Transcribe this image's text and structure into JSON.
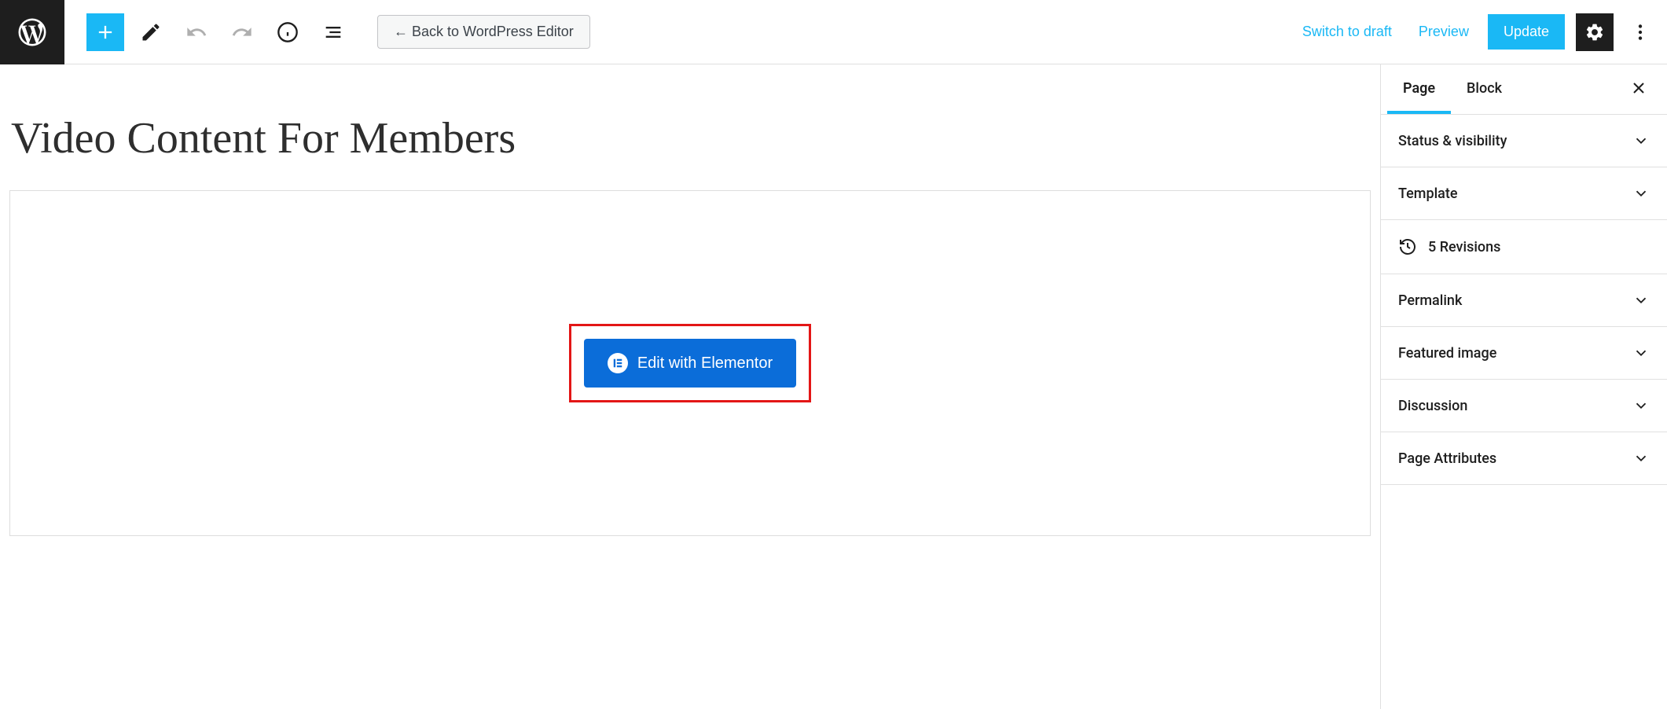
{
  "toolbar": {
    "back_btn_label": "←  Back to WordPress Editor",
    "switch_to_draft": "Switch to draft",
    "preview": "Preview",
    "update": "Update"
  },
  "page": {
    "title": "Video Content For Members"
  },
  "elementor": {
    "edit_label": "Edit with Elementor"
  },
  "sidebar": {
    "tabs": {
      "page": "Page",
      "block": "Block"
    },
    "panels": {
      "status_visibility": "Status & visibility",
      "template": "Template",
      "revisions": "5 Revisions",
      "permalink": "Permalink",
      "featured_image": "Featured image",
      "discussion": "Discussion",
      "page_attributes": "Page Attributes"
    }
  }
}
